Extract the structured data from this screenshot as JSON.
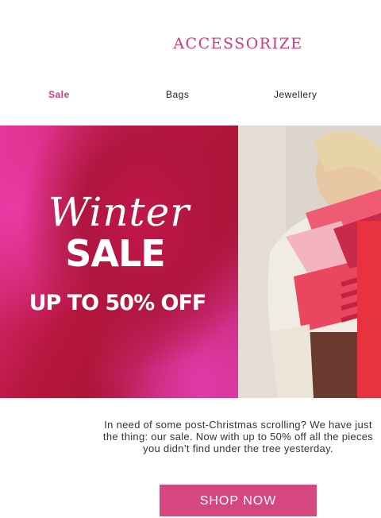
{
  "brand": {
    "logo": "ACCESSORIZE"
  },
  "nav": {
    "sale": "Sale",
    "bags": "Bags",
    "jewellery": "Jewellery"
  },
  "hero": {
    "script_title": "Winter",
    "headline": "SALE",
    "offer": "UP TO 50% OFF"
  },
  "body": {
    "line1": "In need of some post-Christmas scrolling? We have just",
    "line2": "the thing: our sale. Now with up to 50% off all the pieces",
    "line3": "you didn’t find under the tree yesterday."
  },
  "cta": {
    "label": "SHOP NOW"
  },
  "colors": {
    "brand_pink": "#d1397c",
    "button": "#d6477f"
  }
}
